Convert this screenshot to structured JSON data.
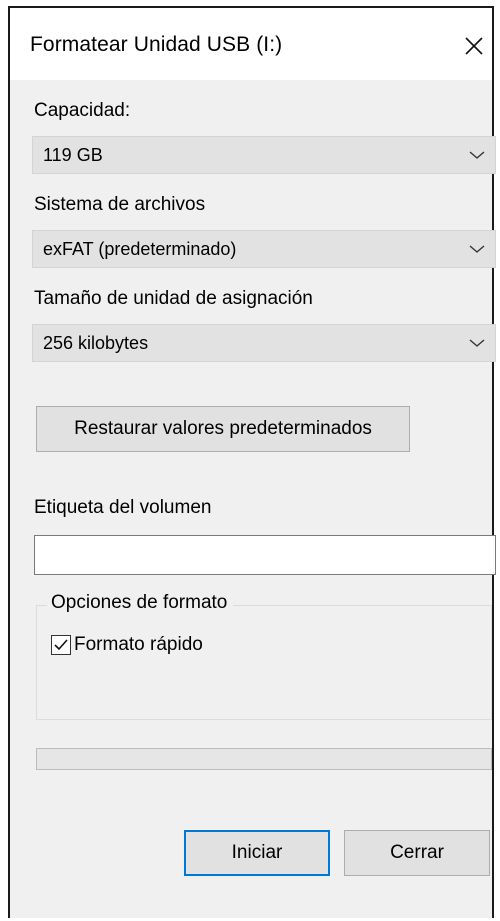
{
  "window": {
    "title": "Formatear Unidad USB (I:)"
  },
  "fields": {
    "capacity": {
      "label": "Capacidad:",
      "value": "119 GB"
    },
    "file_system": {
      "label": "Sistema de archivos",
      "value": "exFAT (predeterminado)"
    },
    "allocation_unit": {
      "label": "Tamaño de unidad de asignación",
      "value": "256 kilobytes"
    }
  },
  "restore_button": "Restaurar valores predeterminados",
  "volume_label": {
    "label": "Etiqueta del volumen",
    "value": ""
  },
  "format_options": {
    "legend": "Opciones de formato",
    "quick_format": {
      "label": "Formato rápido",
      "checked": true
    }
  },
  "progress": {
    "value": 0
  },
  "buttons": {
    "start": "Iniciar",
    "close": "Cerrar"
  },
  "icons": {
    "close": "close-icon",
    "chevron": "chevron-down-icon",
    "check": "check-icon"
  },
  "colors": {
    "dialog_background": "#f0f0f0",
    "title_background": "#ffffff",
    "select_background": "#e2e2e2",
    "default_button_border": "#0078d7"
  }
}
